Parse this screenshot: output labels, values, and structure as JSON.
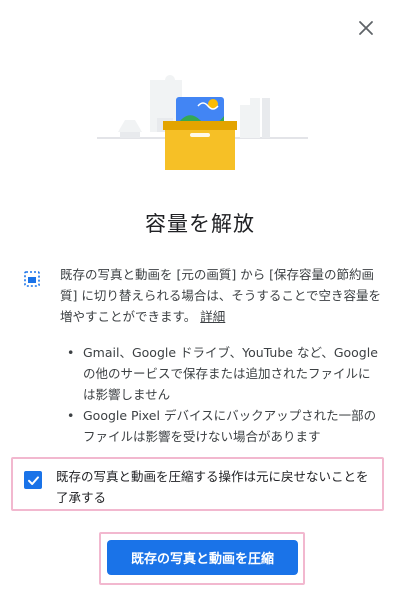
{
  "dialog": {
    "title": "容量を解放",
    "info_text": "既存の写真と動画を [元の画質] から [保存容量の節約画質] に切り替えられる場合は、そうすることで空き容量を増やすことができます。",
    "info_link": "詳細",
    "bullets": [
      "Gmail、Google ドライブ、YouTube など、Google の他のサービスで保存または追加されたファイルには影響しません",
      "Google Pixel デバイスにバックアップされた一部のファイルは影響を受けない場合があります"
    ],
    "acknowledge_text": "既存の写真と動画を圧縮する操作は元に戻せないことを了承する",
    "acknowledge_checked": true,
    "primary_button_label": "既存の写真と動画を圧縮"
  },
  "icons": {
    "close": "close-icon",
    "info": "photo-storage-icon",
    "check": "check-icon",
    "illustration": "storage-box-illustration"
  },
  "colors": {
    "accent": "#1a73e8",
    "highlight_border": "#f2b8cf",
    "box_yellow": "#f6c026",
    "text": "#3c4043"
  }
}
